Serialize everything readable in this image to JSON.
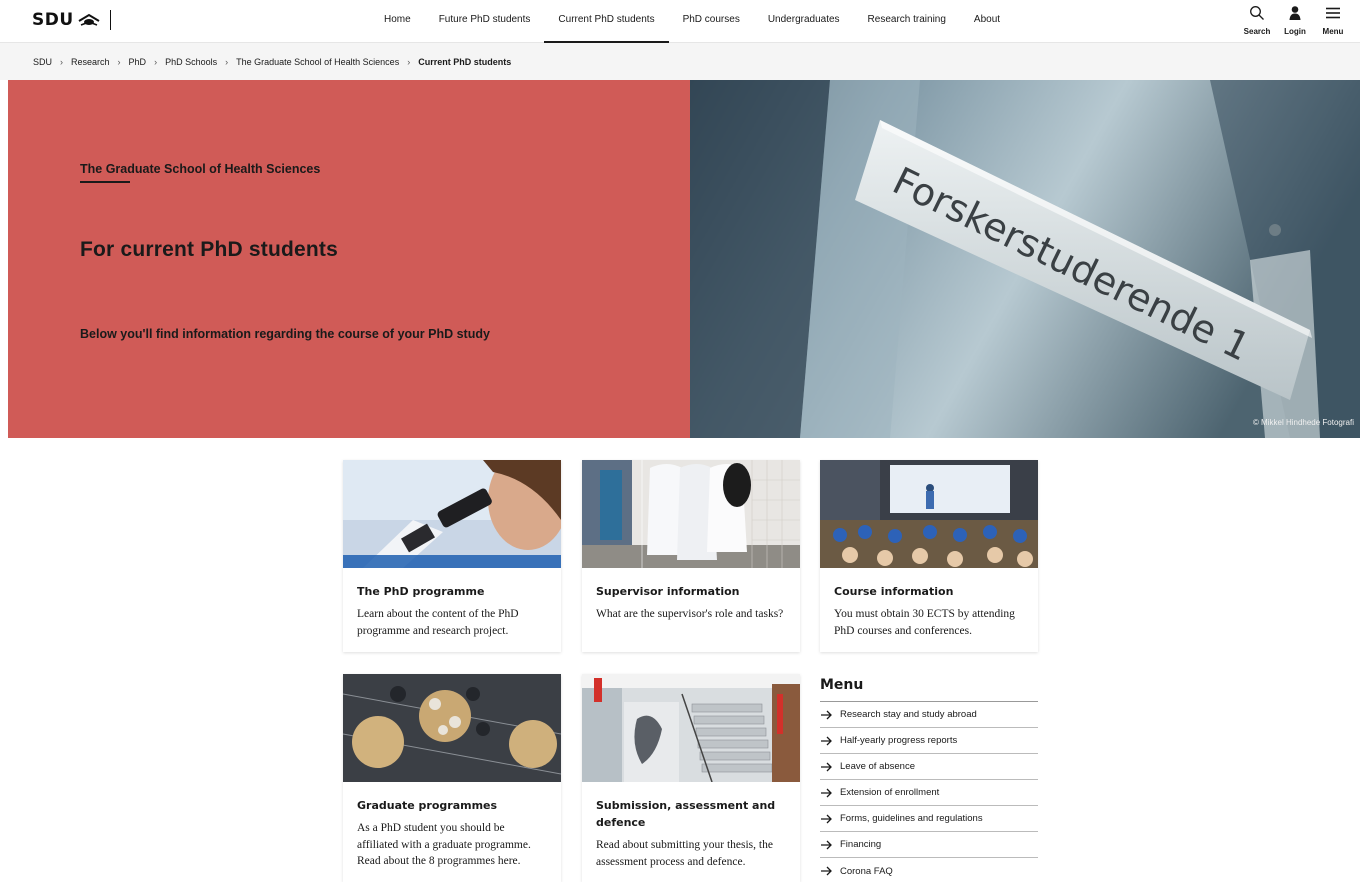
{
  "header": {
    "logo_text": "SDU",
    "nav": [
      {
        "label": "Home",
        "active": false
      },
      {
        "label": "Future PhD students",
        "active": false
      },
      {
        "label": "Current PhD students",
        "active": true
      },
      {
        "label": "PhD courses",
        "active": false
      },
      {
        "label": "Undergraduates",
        "active": false
      },
      {
        "label": "Research training",
        "active": false
      },
      {
        "label": "About",
        "active": false
      }
    ],
    "tools": {
      "search": "Search",
      "login": "Login",
      "menu": "Menu"
    }
  },
  "breadcrumb": {
    "items": [
      "SDU",
      "Research",
      "PhD",
      "PhD Schools",
      "The Graduate School of Health Sciences"
    ],
    "current": "Current PhD students"
  },
  "hero": {
    "kicker": "The Graduate School of Health Sciences",
    "title": "For current PhD students",
    "subtitle": "Below you'll find information regarding the course of your PhD study",
    "image_sign_text": "Forskerstuderende 1",
    "credit": "© Mikkel Hindhede Fotografi",
    "color": "#d05b57"
  },
  "cards": [
    {
      "title": "The PhD programme",
      "text": "Learn about the content of the PhD programme and research project."
    },
    {
      "title": "Supervisor information",
      "text": "What are the supervisor's role and tasks?"
    },
    {
      "title": "Course information",
      "text": "You must obtain 30 ECTS by attending PhD courses and conferences."
    },
    {
      "title": "Graduate programmes",
      "text": "As a PhD student you should be affiliated with a graduate programme. Read about the 8 programmes here."
    },
    {
      "title": "Submission, assessment and defence",
      "text": "Read about submitting your thesis, the assessment process and defence."
    }
  ],
  "side_menu": {
    "title": "Menu",
    "items": [
      "Research stay and study abroad",
      "Half-yearly progress reports",
      "Leave of absence",
      "Extension of enrollment",
      "Forms, guidelines and regulations",
      "Financing",
      "Corona FAQ"
    ]
  }
}
